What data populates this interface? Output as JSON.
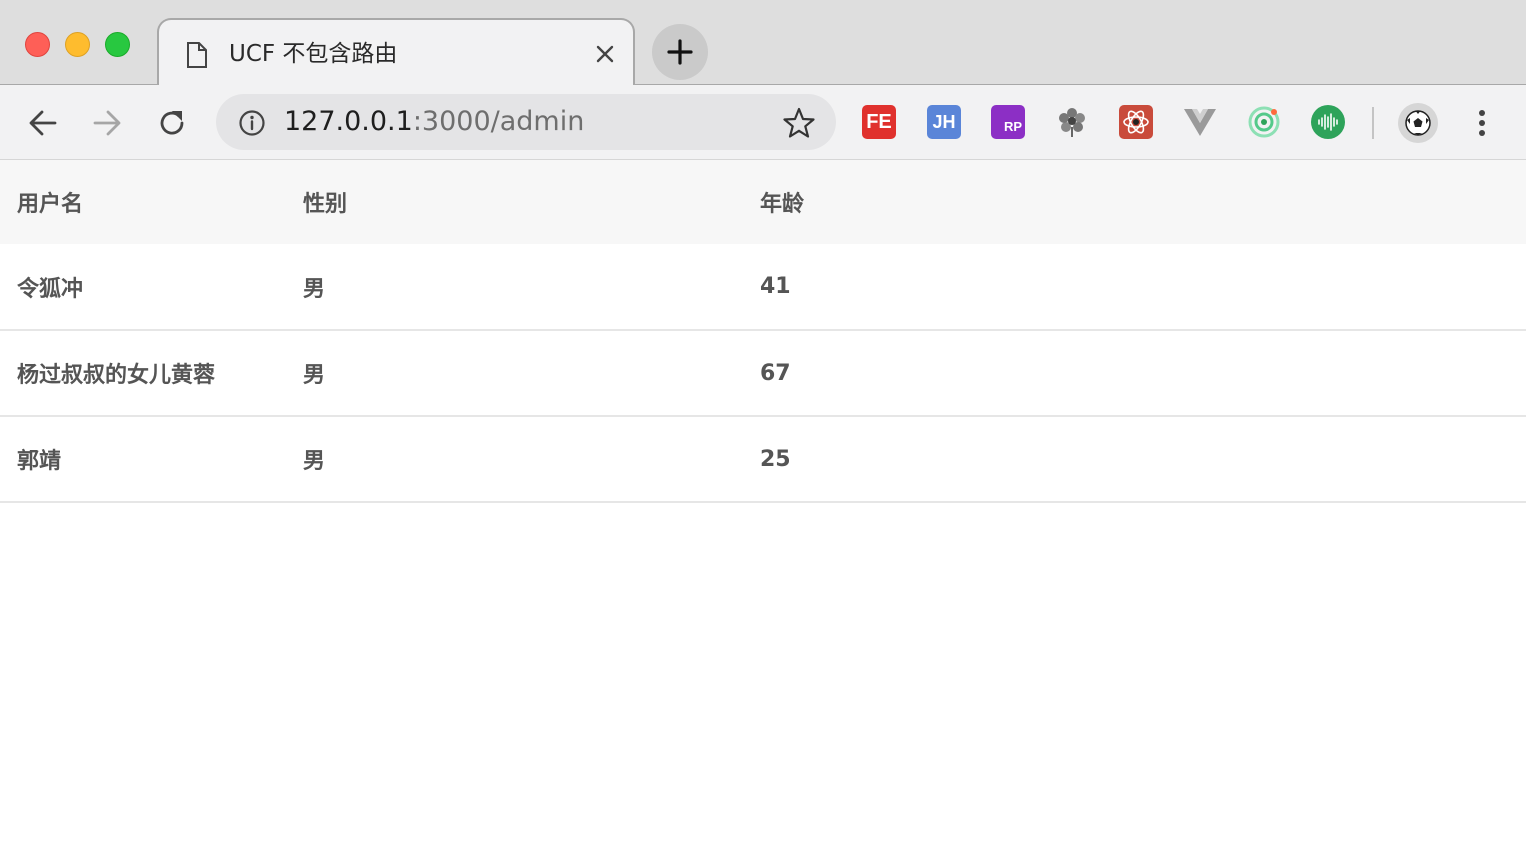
{
  "browser": {
    "tab_title": "UCF 不包含路由",
    "url_host": "127.0.0.1",
    "url_rest": ":3000/admin",
    "extensions": [
      "FE",
      "JH",
      "RP"
    ],
    "colors": {
      "traffic_close": "#fe5f57",
      "traffic_min": "#febc2e",
      "traffic_max": "#28c840"
    }
  },
  "table": {
    "headers": [
      "用户名",
      "性别",
      "年龄"
    ],
    "rows": [
      {
        "name": "令狐冲",
        "gender": "男",
        "age": "41"
      },
      {
        "name": "杨过叔叔的女儿黄蓉",
        "gender": "男",
        "age": "67"
      },
      {
        "name": "郭靖",
        "gender": "男",
        "age": "25"
      }
    ]
  }
}
